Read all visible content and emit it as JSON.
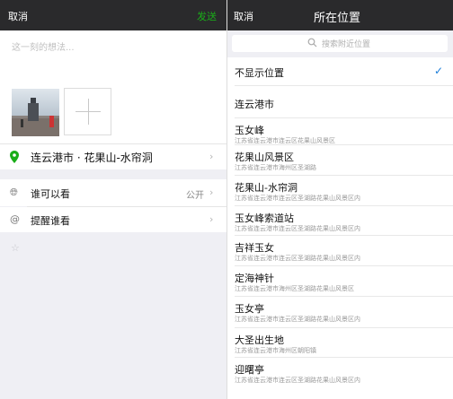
{
  "left": {
    "cancel_label": "取消",
    "send_label": "发送",
    "post_placeholder": "这一刻的想法...",
    "location_label": "连云港市 · 花果山-水帘洞",
    "visibility_label": "谁可以看",
    "visibility_value": "公开",
    "remind_label": "提醒谁看"
  },
  "right": {
    "cancel_label": "取消",
    "title": "所在位置",
    "search_placeholder": "搜索附近位置",
    "hide_location_label": "不显示位置",
    "places": [
      {
        "name": "连云港市",
        "address": ""
      },
      {
        "name": "玉女峰",
        "address": "江苏省连云港市连云区花果山风景区"
      },
      {
        "name": "花果山风景区",
        "address": "江苏省连云港市海州区圣湖路"
      },
      {
        "name": "花果山-水帘洞",
        "address": "江苏省连云港市连云区圣湖路花果山风景区内"
      },
      {
        "name": "玉女峰索道站",
        "address": "江苏省连云港市连云区圣湖路花果山风景区内"
      },
      {
        "name": "吉祥玉女",
        "address": "江苏省连云港市连云区圣湖路花果山风景区内"
      },
      {
        "name": "定海神针",
        "address": "江苏省连云港市海州区圣湖路花果山风景区"
      },
      {
        "name": "玉女亭",
        "address": "江苏省连云港市连云区圣湖路花果山风景区内"
      },
      {
        "name": "大圣出生地",
        "address": "江苏省连云港市海州区朝阳镇"
      },
      {
        "name": "迎曙亭",
        "address": "江苏省连云港市连云区圣湖路花果山风景区内"
      }
    ]
  },
  "colors": {
    "accent_green": "#1aad19",
    "check_blue": "#1a7cd9",
    "topbar": "#2a2a2c"
  }
}
